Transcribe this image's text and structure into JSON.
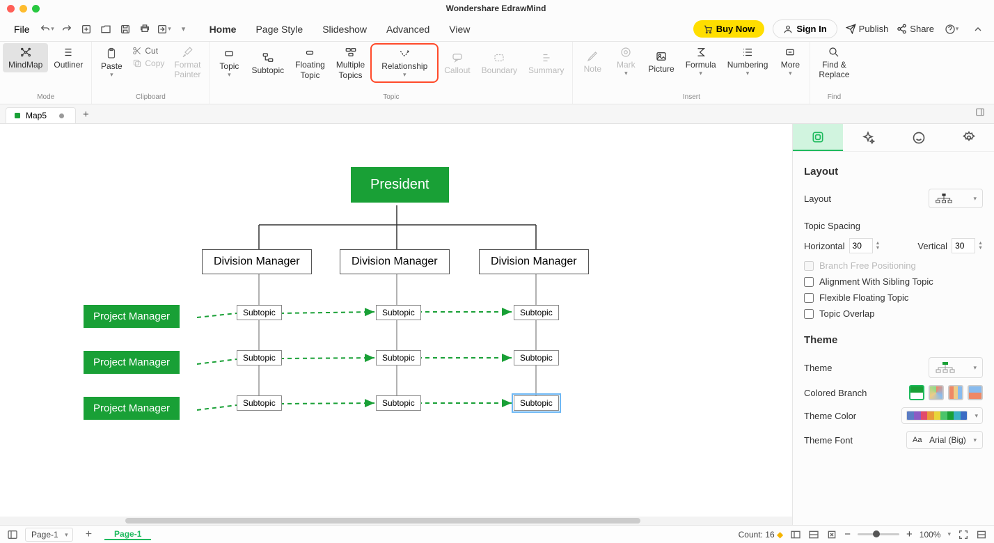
{
  "app_title": "Wondershare EdrawMind",
  "menu": {
    "file": "File"
  },
  "tabs": [
    "Home",
    "Page Style",
    "Slideshow",
    "Advanced",
    "View"
  ],
  "active_tab": "Home",
  "top_actions": {
    "buy": "Buy Now",
    "signin": "Sign In",
    "publish": "Publish",
    "share": "Share"
  },
  "ribbon": {
    "mode": {
      "mindmap": "MindMap",
      "outliner": "Outliner",
      "label": "Mode"
    },
    "clipboard": {
      "paste": "Paste",
      "cut": "Cut",
      "copy": "Copy",
      "format_painter": "Format\nPainter",
      "label": "Clipboard"
    },
    "topic": {
      "topic": "Topic",
      "subtopic": "Subtopic",
      "floating": "Floating\nTopic",
      "multiple": "Multiple\nTopics",
      "relationship": "Relationship",
      "callout": "Callout",
      "boundary": "Boundary",
      "summary": "Summary",
      "label": "Topic"
    },
    "insert": {
      "note": "Note",
      "mark": "Mark",
      "picture": "Picture",
      "formula": "Formula",
      "numbering": "Numbering",
      "more": "More",
      "label": "Insert"
    },
    "find": {
      "find_replace": "Find &\nReplace",
      "label": "Find"
    }
  },
  "doc_tab": "Map5",
  "canvas": {
    "root": "President",
    "divisions": [
      "Division Manager",
      "Division Manager",
      "Division Manager"
    ],
    "subtopic": "Subtopic",
    "project_manager": "Project Manager"
  },
  "panel": {
    "layout_title": "Layout",
    "layout_label": "Layout",
    "topic_spacing": "Topic Spacing",
    "horizontal": "Horizontal",
    "vertical": "Vertical",
    "h_value": "30",
    "v_value": "30",
    "branch_free": "Branch Free Positioning",
    "align_sibling": "Alignment With Sibling Topic",
    "flexible_floating": "Flexible Floating Topic",
    "topic_overlap": "Topic Overlap",
    "theme_title": "Theme",
    "theme_label": "Theme",
    "colored_branch": "Colored Branch",
    "theme_color": "Theme Color",
    "theme_font": "Theme Font",
    "theme_font_value": "Arial (Big)"
  },
  "status": {
    "page_selector": "Page-1",
    "page_tab": "Page-1",
    "count": "Count: 16",
    "zoom": "100%"
  }
}
